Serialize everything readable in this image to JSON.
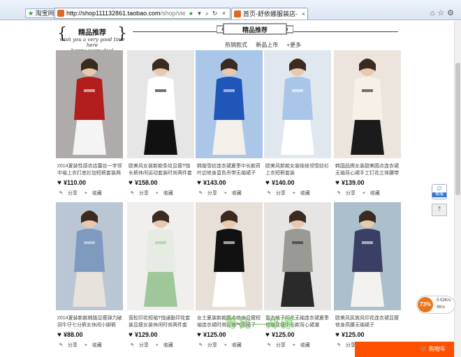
{
  "browser": {
    "favorites_label": "淘宝网",
    "url_domain": "http://shop111132861.taobao.com",
    "url_path": "/shop/view_shop.htm?travel",
    "tab_title": "首页-舒依娜服装店-淘宝网",
    "tab_close": "×"
  },
  "shop": {
    "brand_name": "精品推荐",
    "slogan_line1": "wish you a very good time here",
    "slogan_line2": "happy every day!",
    "section_title": "精品推荐",
    "sort_links": [
      "热销款式",
      "新品上市",
      "+更多"
    ]
  },
  "products": [
    {
      "desc": "2014夏装性感衣店蕾丝一字领中袖上衣打底衫加短裤套装两件套",
      "price": "¥110.00",
      "share": "分享",
      "fav": "收藏",
      "palette": [
        "#b21d1d",
        "#f4f4f4",
        "#3a2f2a"
      ]
    },
    {
      "desc": "欧美风女装新款条纹显瘦T恤长裤休闲运动套装时尚两件套潮",
      "price": "¥158.00",
      "share": "分享",
      "fav": "收藏",
      "palette": [
        "#ffffff",
        "#111111",
        "#d7d7d7"
      ]
    },
    {
      "desc": "韩版雪纺连衣裙夏季中长款荷叶边修身蓝色吊带无袖裙子",
      "price": "¥143.00",
      "share": "分享",
      "fav": "收藏",
      "palette": [
        "#1f56b8",
        "#f3efe9",
        "#2a7de1"
      ]
    },
    {
      "desc": "欧美风新款女装娃娃领雪纺衫上衣短裤套装",
      "price": "¥140.00",
      "share": "分享",
      "fav": "收藏",
      "palette": [
        "#a9c6ea",
        "#ffffff",
        "#c9d9ee"
      ]
    },
    {
      "desc": "韩国品牌女装甜美圆点连衣裙无袖背心裙手工钉花立体腰带",
      "price": "¥139.00",
      "share": "分享",
      "fav": "收藏",
      "palette": [
        "#f6f0e6",
        "#1b1b1b",
        "#e8d5bf"
      ]
    },
    {
      "desc": "2014夏装新款韩版显瘦弹力破洞牛仔七分裤女休闲小脚裤",
      "price": "¥88.00",
      "share": "分享",
      "fav": "收藏",
      "palette": [
        "#7e9bbf",
        "#e7e2dc",
        "#5b7ca3"
      ]
    },
    {
      "desc": "宽松印花短袖T恤通勤印花套装显瘦女装休闲时尚两件套",
      "price": "¥129.00",
      "share": "分享",
      "fav": "收藏",
      "palette": [
        "#e6ece4",
        "#9ec79a",
        "#f3f1ea"
      ]
    },
    {
      "desc": "女士夏装新款圆点修身显瘦短袖连衣裙时尚百搭气质裙子",
      "price": "¥125.00",
      "share": "分享",
      "fav": "收藏",
      "palette": [
        "#111111",
        "#ffffff",
        "#d9c6b0"
      ]
    },
    {
      "desc": "复古格子印花无袖连衣裙夏季修身显瘦中长款背心裙潮",
      "price": "¥125.00",
      "share": "分享",
      "fav": "收藏",
      "palette": [
        "#9a9a94",
        "#2a2a2a",
        "#d8d5ce"
      ]
    },
    {
      "desc": "欧美风民族风印花连衣裙显瘦修身高腰无袖裙子",
      "price": "¥125.00",
      "share": "分享",
      "fav": "收藏",
      "palette": [
        "#3a3f66",
        "#f4f2ee",
        "#2d6b8c"
      ]
    }
  ],
  "widgets": {
    "service_label": "客服",
    "speed_percent": "73%",
    "speed_up": "0.02K/s",
    "speed_down": "0K/s",
    "cart_label": "购物车",
    "watermark": "等比—郑源"
  },
  "icons": {
    "heart": "heart-icon",
    "share": "share-icon",
    "fav": "plus-icon",
    "top": "back-to-top-icon"
  }
}
